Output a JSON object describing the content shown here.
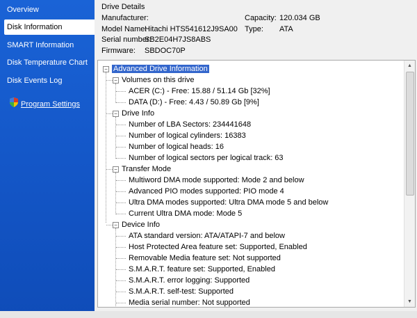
{
  "sidebar": {
    "items": [
      {
        "label": "Overview"
      },
      {
        "label": "Disk Information"
      },
      {
        "label": "SMART Information"
      },
      {
        "label": "Disk Temperature Chart"
      },
      {
        "label": "Disk Events Log"
      }
    ],
    "settings_label": "Program Settings"
  },
  "details": {
    "section_title": "Drive Details",
    "manufacturer_label": "Manufacturer:",
    "manufacturer_value": "",
    "model_label": "Model Name:",
    "model_value": "Hitachi HTS541612J9SA00",
    "serial_label": "Serial number:",
    "serial_value": "SB2E04H7JS8ABS",
    "firmware_label": "Firmware:",
    "firmware_value": "SBDOC70P",
    "capacity_label": "Capacity:",
    "capacity_value": "120.034 GB",
    "type_label": "Type:",
    "type_value": "ATA"
  },
  "tree": {
    "root": "Advanced Drive Information",
    "groups": [
      {
        "label": "Volumes on this drive",
        "items": [
          "ACER (C:) - Free: 15.88 / 51.14 Gb [32%]",
          "DATA (D:) - Free: 4.43 / 50.89 Gb [9%]"
        ]
      },
      {
        "label": "Drive Info",
        "items": [
          "Number of LBA Sectors: 234441648",
          "Number of logical cylinders: 16383",
          "Number of logical heads: 16",
          "Number of logical sectors per logical track: 63"
        ]
      },
      {
        "label": "Transfer Mode",
        "items": [
          "Multiword DMA mode supported: Mode 2 and below",
          "Advanced PIO modes supported: PIO mode 4",
          "Ultra DMA modes supported: Ultra DMA mode 5 and below",
          "Current Ultra DMA mode: Mode 5"
        ]
      },
      {
        "label": "Device Info",
        "items": [
          "ATA standard version: ATA/ATAPI-7 and below",
          "Host Protected Area feature set: Supported, Enabled",
          "Removable Media feature set: Not supported",
          "S.M.A.R.T. feature set: Supported, Enabled",
          "S.M.A.R.T. error logging: Supported",
          "S.M.A.R.T. self-test: Supported",
          "Media serial number: Not supported"
        ]
      }
    ]
  },
  "icons": {
    "settings": "shield-icon",
    "expander": "minus-box-icon",
    "scroll_up": "arrow-up-icon",
    "scroll_down": "arrow-down-icon"
  },
  "colors": {
    "sidebar_blue": "#1457c8",
    "selection_blue": "#3366cc"
  }
}
